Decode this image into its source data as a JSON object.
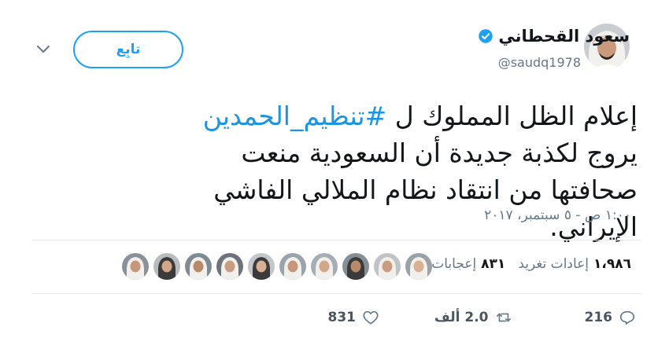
{
  "author": {
    "display_name": "سعود القحطاني",
    "handle": "@saudq1978",
    "verified": true
  },
  "follow_button": {
    "label": "تابِع"
  },
  "tweet": {
    "text_before": "إعلام الظل المملوك ل ",
    "hashtag": "#تنظيم_الحمدين",
    "text_after": " يروج لكذبة جديدة أن السعودية منعت صحافتها من انتقاد نظام الملالي الفاشي الإيراني.",
    "timestamp": "١:٠٠ ص - ٥ سبتمبر، ٢٠١٧"
  },
  "stats": {
    "retweets_count": "١،٩٨٦",
    "retweets_label": "إعادات تغريد",
    "likes_count": "٨٣١",
    "likes_label": "إعجابات"
  },
  "engagers": {
    "count_shown": 10
  },
  "actions": {
    "reply_count": "216",
    "retweet_count": "2.0 ألف",
    "like_count": "831"
  },
  "icons": {
    "verified": "verified-badge-icon",
    "caret": "chevron-down-icon",
    "reply": "reply-icon",
    "retweet": "retweet-icon",
    "like": "heart-icon"
  },
  "colors": {
    "accent": "#1da1f2",
    "hashtag": "#1b95e0",
    "muted": "#657786",
    "text": "#14171a"
  }
}
